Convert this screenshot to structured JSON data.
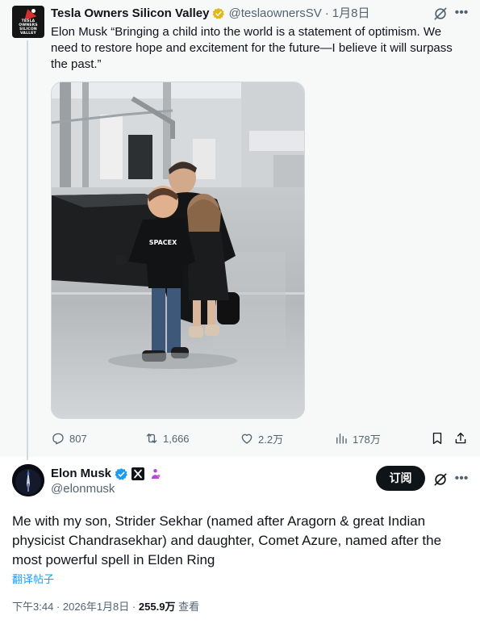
{
  "quoted_post": {
    "author_name": "Tesla Owners Silicon Valley",
    "handle": "@teslaownersSV",
    "separator": "·",
    "date": "1月8日",
    "avatar_text": "TESLA OWNERS SILICON VALLEY",
    "text": "Elon Musk “Bringing a child into the world is a statement of optimism. We need to restore hope and excitement for the future—I believe it will surpass the past.”",
    "photo_overlay_text": "SPACEX",
    "stats": {
      "replies": "807",
      "reposts": "1,666",
      "likes": "2.2万",
      "views": "178万"
    }
  },
  "main_post": {
    "author_name": "Elon Musk",
    "handle": "@elonmusk",
    "subscribe_label": "订阅",
    "text": "Me with my son, Strider Sekhar (named after Aragorn & great Indian physicist Chandrasekhar) and daughter, Comet Azure, named after the most powerful spell in Elden Ring",
    "translate_label": "翻译帖子",
    "time": "下午3:44",
    "separator": "·",
    "date": "2026年1月8日",
    "view_count": "255.9万",
    "views_label": "查看"
  },
  "colors": {
    "link_blue": "#1d9bf0",
    "gold_badge": "#e2b719",
    "blue_badge": "#1d9bf0",
    "muted": "#536471",
    "text": "#0f1419"
  },
  "icons": [
    "verified-gold-icon",
    "grok-icon",
    "more-icon",
    "reply-icon",
    "repost-icon",
    "like-icon",
    "views-icon",
    "bookmark-icon",
    "share-icon",
    "verified-blue-icon",
    "x-affiliate-icon",
    "affiliate-people-icon"
  ]
}
